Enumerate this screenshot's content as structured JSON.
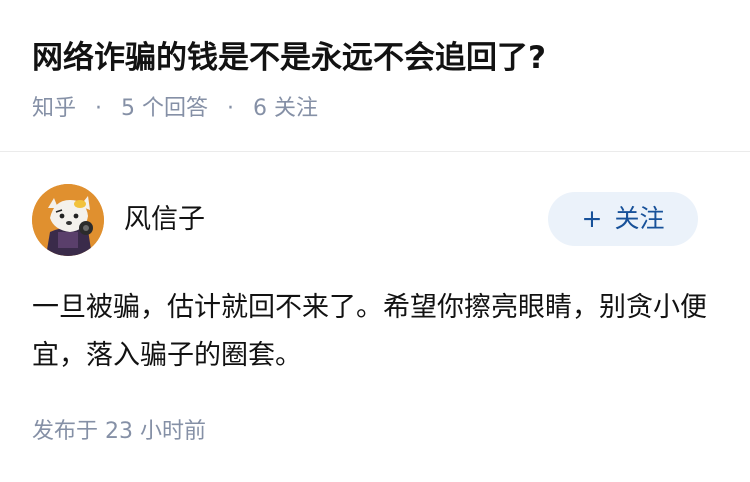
{
  "question": {
    "title": "网络诈骗的钱是不是永远不会追回了?",
    "meta": {
      "source": "知乎",
      "separator": "·",
      "answers": "5 个回答",
      "followers": "6 关注"
    }
  },
  "answer": {
    "author": {
      "name": "风信子",
      "avatar_icon": "avatar-cartoon-icon"
    },
    "follow_button": {
      "plus": "+",
      "label": "关注"
    },
    "content": "一旦被骗，估计就回不来了。希望你擦亮眼睛，别贪小便宜，落入骗子的圈套。",
    "published": "发布于 23 小时前"
  },
  "colors": {
    "meta_text": "#8590a6",
    "follow_bg": "#ebf2fa",
    "follow_text": "#175199",
    "avatar_bg": "#e0902f"
  }
}
